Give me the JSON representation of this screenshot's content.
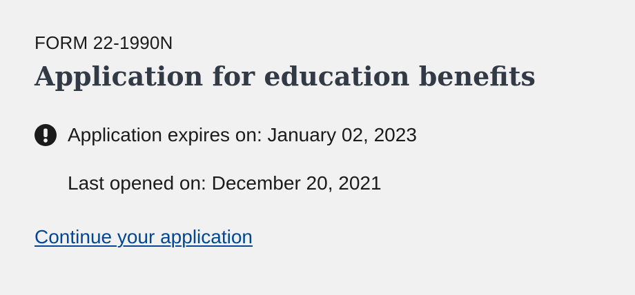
{
  "form": {
    "number": "FORM 22-1990N",
    "title": "Application for education benefits"
  },
  "status": {
    "icon": "exclamation-circle-icon",
    "expires_text": "Application expires on: January 02, 2023",
    "last_opened_text": "Last opened on: December 20, 2021"
  },
  "actions": {
    "continue_label": "Continue your application"
  },
  "colors": {
    "background": "#f1f1f1",
    "title": "#323a45",
    "link": "#004795",
    "icon": "#1b1b1b"
  }
}
